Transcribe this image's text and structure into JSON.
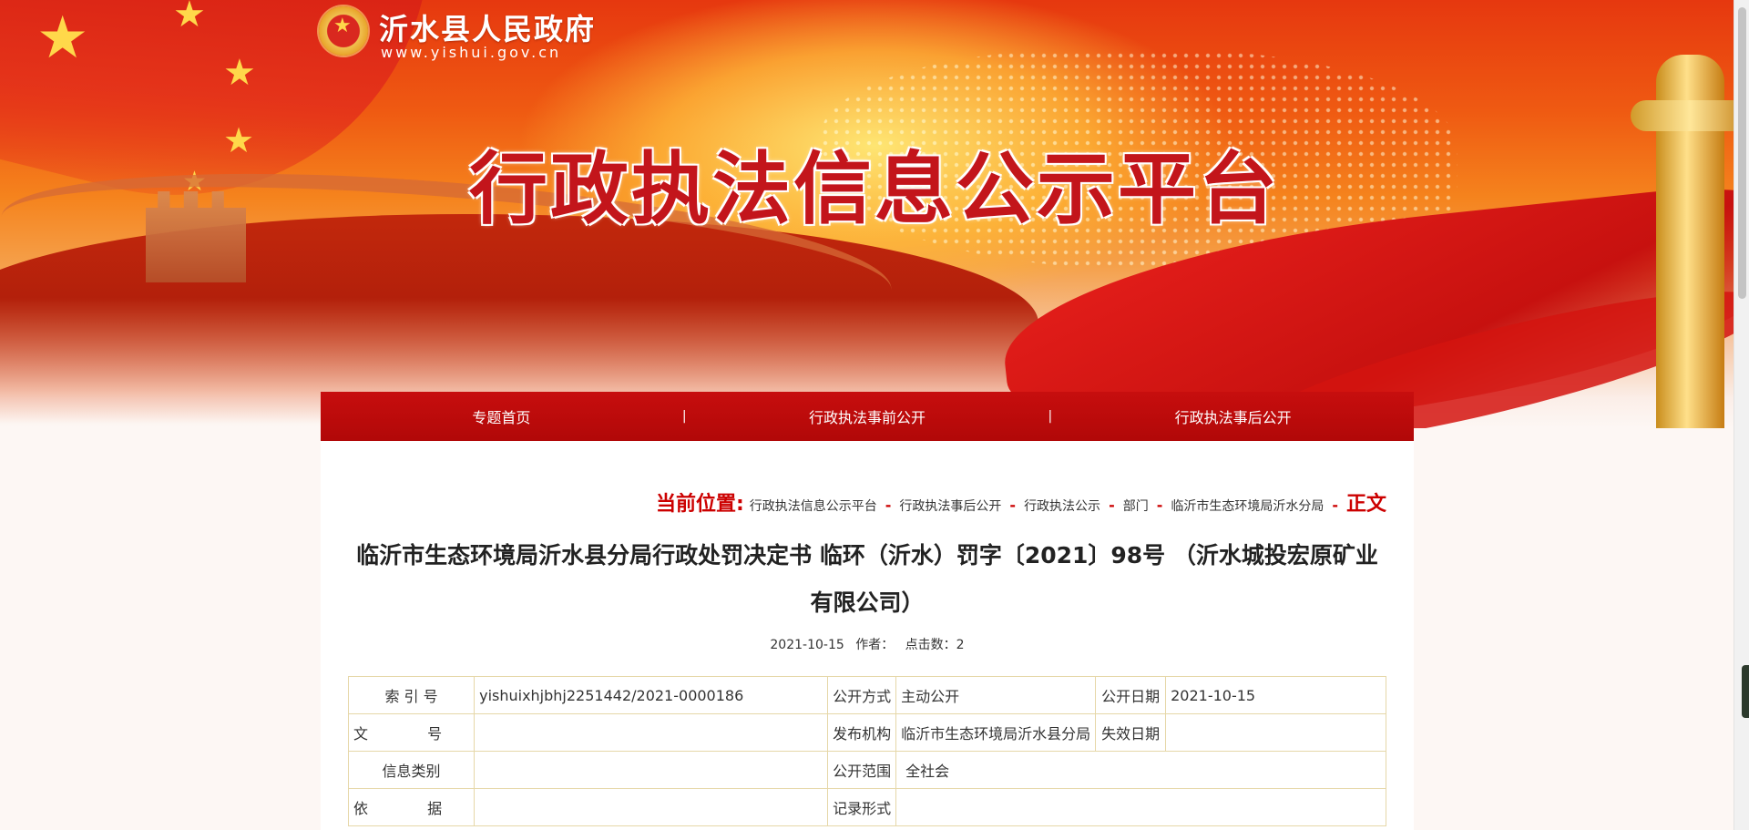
{
  "header": {
    "site_name": "沂水县人民政府",
    "site_url": "www.yishui.gov.cn",
    "banner_title": "行政执法信息公示平台"
  },
  "nav": {
    "items": [
      "专题首页",
      "行政执法事前公开",
      "行政执法事后公开"
    ],
    "separator": "|"
  },
  "breadcrumb": {
    "label": "当前位置:",
    "items": [
      "行政执法信息公示平台",
      "行政执法事后公开",
      "行政执法公示",
      "部门",
      "临沂市生态环境局沂水分局"
    ],
    "separator": "-",
    "current": "正文"
  },
  "article": {
    "title": "临沂市生态环境局沂水县分局行政处罚决定书 临环（沂水）罚字〔2021〕98号 （沂水城投宏原矿业有限公司）",
    "date": "2021-10-15",
    "author_label": "作者：",
    "clicks_label": "点击数：",
    "clicks": "2"
  },
  "info_table": {
    "rows": [
      {
        "l1": "索 引 号",
        "v1": "yishuixhjbhj2251442/2021-0000186",
        "l2": "公开方式",
        "v2": "主动公开",
        "l3": "公开日期",
        "v3": "2021-10-15"
      },
      {
        "l1": "文 号",
        "v1": "",
        "l2": "发布机构",
        "v2": "临沂市生态环境局沂水县分局",
        "l3": "失效日期",
        "v3": ""
      },
      {
        "l1": "信息类别",
        "v1": "",
        "l2": "公开范围",
        "v2": "全社会"
      },
      {
        "l1": "依 据",
        "v1": "",
        "l2": "记录形式",
        "v2": ""
      }
    ]
  },
  "colors": {
    "nav_red": "#b80a0a",
    "accent_red": "#cc0000",
    "table_border": "#e6d7a8"
  }
}
